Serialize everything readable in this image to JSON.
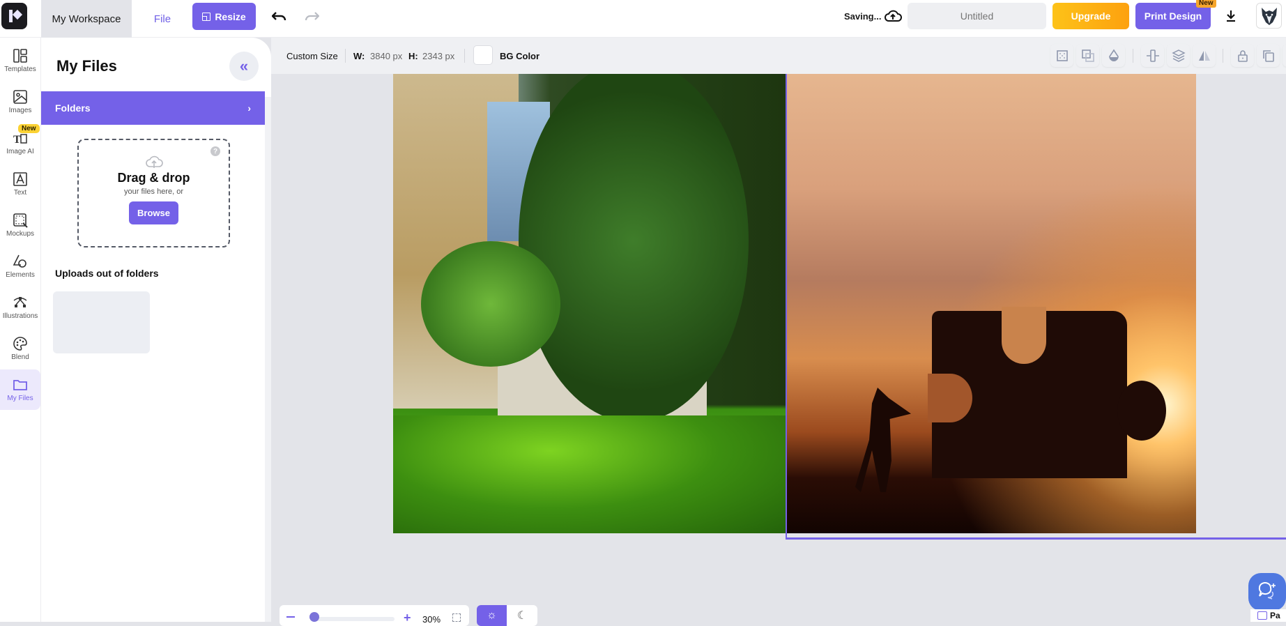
{
  "header": {
    "logo": "app-logo",
    "workspace_tab": "My Workspace",
    "file_label": "File",
    "resize_label": "Resize",
    "save_status": "Saving...",
    "title_placeholder": "Untitled",
    "title_value": "",
    "upgrade_label": "Upgrade",
    "print_label": "Print Design",
    "print_badge": "New",
    "icons": [
      "undo-icon",
      "redo-icon",
      "cloud-upload-icon",
      "download-icon",
      "wolf-avatar"
    ]
  },
  "rail": {
    "items": [
      {
        "label": "Templates",
        "icon": "templates-icon"
      },
      {
        "label": "Images",
        "icon": "image-icon"
      },
      {
        "label": "Image AI",
        "icon": "image-ai-icon",
        "badge": "New"
      },
      {
        "label": "Text",
        "icon": "text-icon"
      },
      {
        "label": "Mockups",
        "icon": "mockup-icon"
      },
      {
        "label": "Elements",
        "icon": "shapes-icon"
      },
      {
        "label": "Illustrations",
        "icon": "pen-tool-icon"
      },
      {
        "label": "Blend",
        "icon": "palette-icon"
      },
      {
        "label": "My Files",
        "icon": "folder-icon",
        "active": true
      }
    ]
  },
  "panel": {
    "title": "My Files",
    "folders_label": "Folders",
    "dropzone": {
      "title": "Drag & drop",
      "subtitle": "your files here, or",
      "browse_label": "Browse",
      "help": "?"
    },
    "uploads_title": "Uploads out of folders"
  },
  "canvas_toolbar": {
    "size_preset": "Custom Size",
    "width_label": "W:",
    "width_value": "3840 px",
    "height_label": "H:",
    "height_value": "2343 px",
    "bg_color_label": "BG Color",
    "bg_color": "#ffffff",
    "tools": [
      "grid-icon",
      "overlap-icon",
      "opacity-icon",
      "align-center-icon",
      "layers-icon",
      "flip-icon",
      "lock-icon",
      "duplicate-icon",
      "trash-icon"
    ]
  },
  "canvas": {
    "images": [
      {
        "name": "campus-photo",
        "desc": "University building with trees and lawn"
      },
      {
        "name": "puzzle-sunset-photo",
        "desc": "Silhouette pushing giant puzzle piece at sunset"
      }
    ],
    "selected": "puzzle-sunset-photo"
  },
  "zoom": {
    "value": "30%",
    "level": 0.3,
    "minus": "−",
    "plus": "+"
  },
  "theme": {
    "light_icon": "☼",
    "dark_icon": "☾",
    "active": "light"
  },
  "page_chip_label": "Pa",
  "colors": {
    "accent": "#7461e8",
    "upgrade": "#fdb016",
    "canvas_bg": "#e3e4e9",
    "chat": "#4f78e0"
  }
}
